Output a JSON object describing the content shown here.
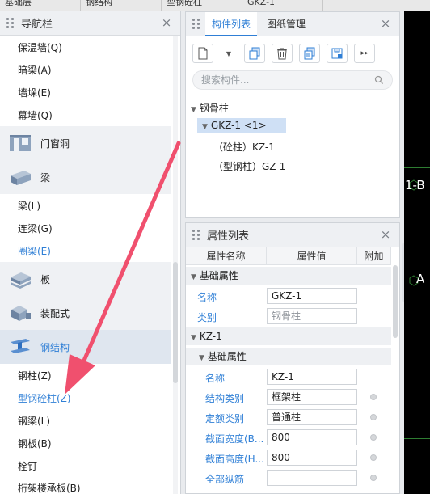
{
  "top_tabs": [
    "基础层",
    "钢结构",
    "型钢砼柱",
    "GKZ-1"
  ],
  "nav": {
    "title": "导航栏",
    "items_top": [
      "保温墙(Q)",
      "暗梁(A)",
      "墙垛(E)",
      "幕墙(Q)"
    ],
    "cat_door": "门窗洞",
    "cat_beam": "梁",
    "beam_items": [
      "梁(L)",
      "连梁(G)",
      "圈梁(E)"
    ],
    "cat_slab": "板",
    "cat_prefab": "装配式",
    "cat_steel": "钢结构",
    "steel_items": [
      "钢柱(Z)",
      "型钢砼柱(Z)",
      "钢梁(L)",
      "钢板(B)",
      "栓钉",
      "桁架楼承板(B)"
    ]
  },
  "comp_panel": {
    "tab_components": "构件列表",
    "tab_drawings": "图纸管理",
    "search_placeholder": "搜索构件...",
    "tree_root": "钢骨柱",
    "tree_selected": "GKZ-1 <1>",
    "tree_child1": "（砼柱）KZ-1",
    "tree_child2": "（型钢柱）GZ-1"
  },
  "prop_panel": {
    "title": "属性列表",
    "col_name": "属性名称",
    "col_value": "属性值",
    "col_extra": "附加",
    "group_basic": "基础属性",
    "name_label": "名称",
    "name_value": "GKZ-1",
    "type_label": "类别",
    "type_value": "钢骨柱",
    "sub_group": "KZ-1",
    "sub_basic": "基础属性",
    "sub_name_label": "名称",
    "sub_name_value": "KZ-1",
    "struct_label": "结构类别",
    "struct_value": "框架柱",
    "quota_label": "定额类别",
    "quota_value": "普通柱",
    "width_label": "截面宽度(B...",
    "width_value": "800",
    "height_label": "截面高度(H...",
    "height_value": "800",
    "rebar_label": "全部纵筋",
    "rebar_value": ""
  },
  "canvas": {
    "label_1b": "1-B",
    "label_a": "A"
  },
  "colors": {
    "accent": "#2f7fd6",
    "arrow": "#f0506e"
  }
}
